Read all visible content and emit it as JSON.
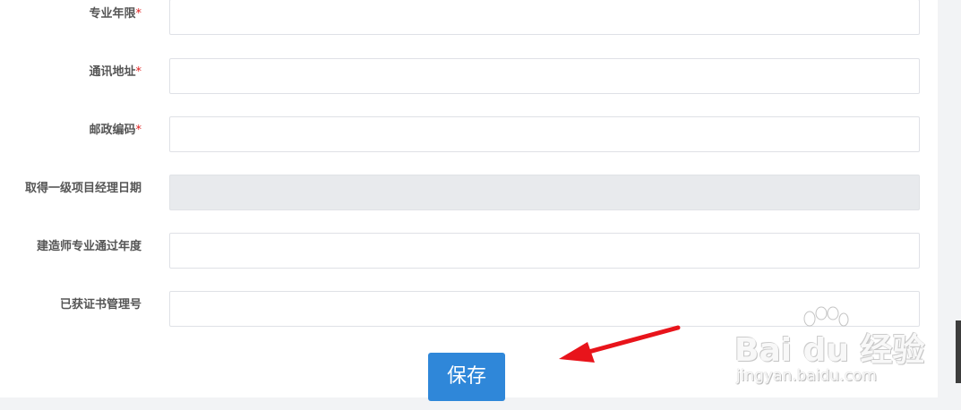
{
  "form": {
    "fields": [
      {
        "label": "专业年限",
        "required_mark": "*",
        "value": "",
        "disabled": false
      },
      {
        "label": "通讯地址",
        "required_mark": "*",
        "value": "",
        "disabled": false
      },
      {
        "label": "邮政编码",
        "required_mark": "*",
        "value": "",
        "disabled": false
      },
      {
        "label": "取得一级项目经理日期",
        "required_mark": "",
        "value": "",
        "disabled": true
      },
      {
        "label": "建造师专业通过年度",
        "required_mark": "",
        "value": "",
        "disabled": false
      },
      {
        "label": "已获证书管理号",
        "required_mark": "",
        "value": "",
        "disabled": false
      }
    ],
    "save_label": "保存"
  },
  "watermark": {
    "brand": "Bai du 经验",
    "url": "jingyan.baidu.com"
  },
  "colors": {
    "accent": "#2f87d9",
    "required": "#e02020",
    "arrow": "#e8141b",
    "disabled_bg": "#e8eaed"
  },
  "annotations": {
    "arrow": "red-pointer-arrow"
  }
}
